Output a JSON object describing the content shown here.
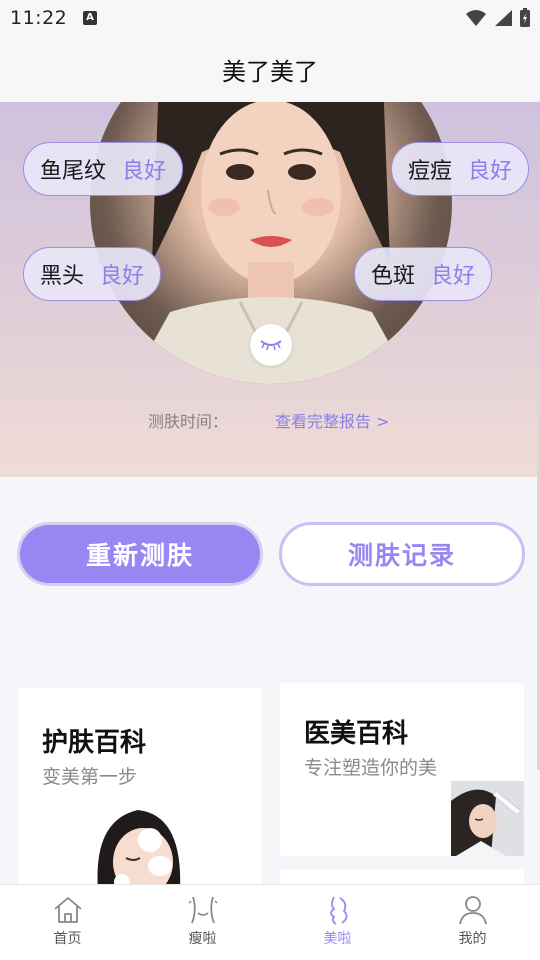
{
  "status_bar": {
    "time": "11:22",
    "app_badge": "A"
  },
  "header": {
    "title": "美了美了"
  },
  "hero": {
    "metrics": [
      {
        "name": "鱼尾纹",
        "value": "良好"
      },
      {
        "name": "痘痘",
        "value": "良好"
      },
      {
        "name": "黑头",
        "value": "良好"
      },
      {
        "name": "色斑",
        "value": "良好"
      }
    ],
    "scan_time_label": "测肤时间：",
    "report_link": "查看完整报告 >"
  },
  "actions": {
    "rescan": "重新测肤",
    "history": "测肤记录"
  },
  "cards": {
    "skincare": {
      "title": "护肤百科",
      "subtitle": "变美第一步"
    },
    "aesthetic": {
      "title": "医美百科",
      "subtitle": "专注塑造你的美"
    }
  },
  "tabs": [
    {
      "label": "首页",
      "icon": "home-icon"
    },
    {
      "label": "瘦啦",
      "icon": "waist-icon"
    },
    {
      "label": "美啦",
      "icon": "face-profile-icon"
    },
    {
      "label": "我的",
      "icon": "user-icon"
    }
  ],
  "colors": {
    "accent": "#9a86f2",
    "accent_light": "#c9bff6",
    "value_text": "#8c7fe8"
  }
}
